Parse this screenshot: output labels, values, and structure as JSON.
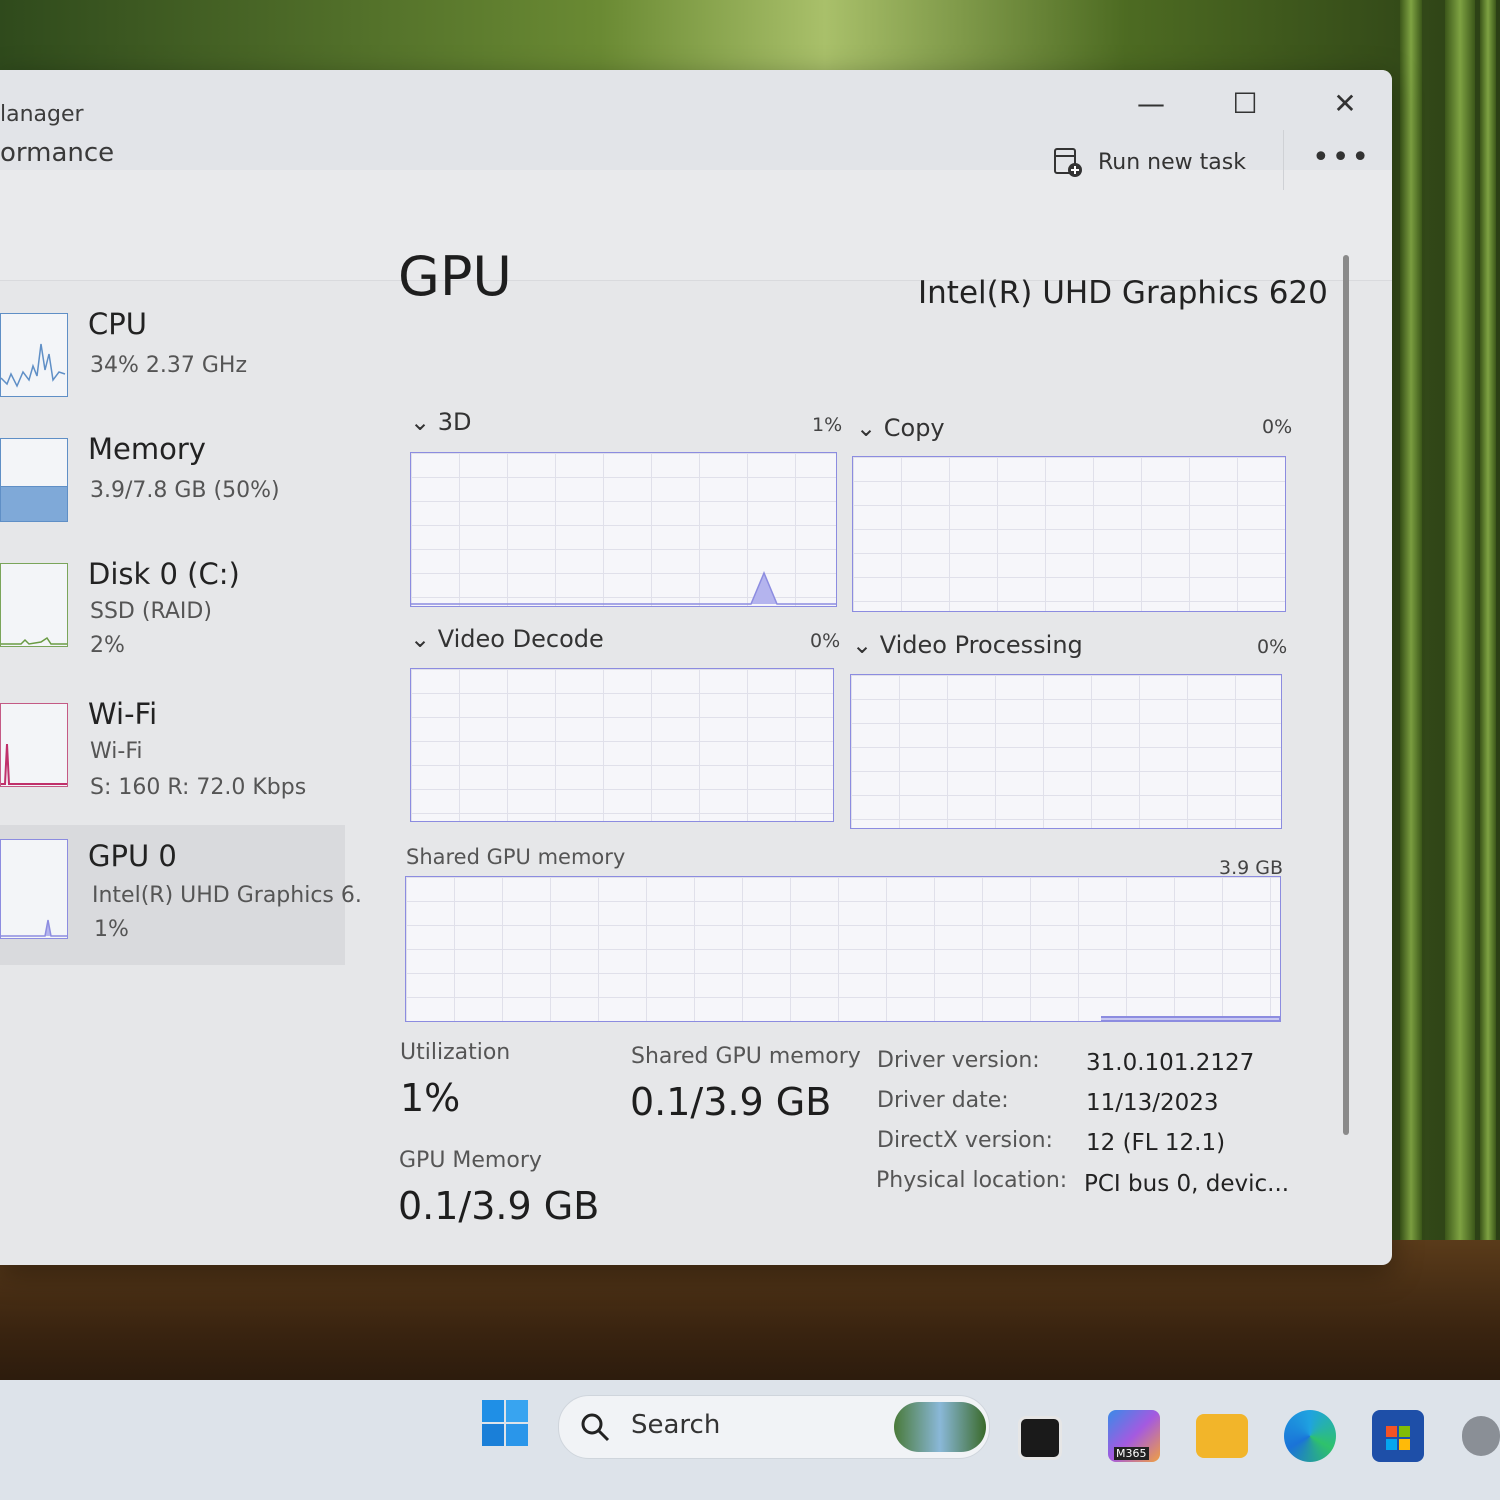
{
  "window": {
    "app_title": "lanager",
    "page_title": "ormance",
    "run_new_task": "Run new task",
    "more": "•••",
    "controls": {
      "minimize": "—",
      "maximize": "☐",
      "close": "✕"
    }
  },
  "sidebar": {
    "items": [
      {
        "name": "CPU",
        "sub1": "34%  2.37 GHz",
        "sub2": ""
      },
      {
        "name": "Memory",
        "sub1": "3.9/7.8 GB (50%)",
        "sub2": ""
      },
      {
        "name": "Disk 0 (C:)",
        "sub1": "SSD (RAID)",
        "sub2": "2%"
      },
      {
        "name": "Wi-Fi",
        "sub1": "Wi-Fi",
        "sub2": "S: 160  R: 72.0 Kbps"
      },
      {
        "name": "GPU 0",
        "sub1": "Intel(R) UHD Graphics 6.",
        "sub2": "1%"
      }
    ]
  },
  "gpu": {
    "title": "GPU",
    "model": "Intel(R) UHD Graphics 620",
    "engines": [
      {
        "label": "3D",
        "pct": "1%"
      },
      {
        "label": "Copy",
        "pct": "0%"
      },
      {
        "label": "Video Decode",
        "pct": "0%"
      },
      {
        "label": "Video Processing",
        "pct": "0%"
      }
    ],
    "shared_memory_label": "Shared GPU memory",
    "shared_memory_max": "3.9 GB",
    "stats": {
      "utilization_label": "Utilization",
      "utilization_value": "1%",
      "shared_label": "Shared GPU memory",
      "shared_value": "0.1/3.9 GB",
      "gpu_memory_label": "GPU Memory",
      "gpu_memory_value": "0.1/3.9 GB"
    },
    "details": [
      {
        "key": "Driver version:",
        "value": "31.0.101.2127"
      },
      {
        "key": "Driver date:",
        "value": "11/13/2023"
      },
      {
        "key": "DirectX version:",
        "value": "12 (FL 12.1)"
      },
      {
        "key": "Physical location:",
        "value": "PCI bus 0, devic..."
      }
    ]
  },
  "taskbar": {
    "search_placeholder": "Search",
    "m365_label": "M365"
  },
  "colors": {
    "accent": "#0078d4",
    "graph_line": "#8c8ce0",
    "wifi_spike": "#c0306a"
  }
}
